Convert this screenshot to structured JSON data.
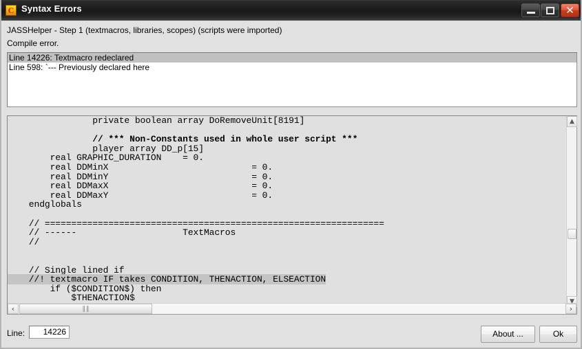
{
  "window": {
    "title": "Syntax Errors",
    "icon": "compiler-c-icon",
    "icon_letter": "C",
    "controls": {
      "minimize": "minimize-icon",
      "maximize": "maximize-icon",
      "close": "close-icon",
      "close_glyph": "✕"
    }
  },
  "header": {
    "line1": "JASSHelper - Step 1 (textmacros, libraries, scopes) (scripts were imported)",
    "line2": "Compile error."
  },
  "error_list": {
    "items": [
      {
        "text": "Line 14226: Textmacro redeclared",
        "selected": true
      },
      {
        "text": "Line 598: `--- Previously declared here",
        "selected": false
      }
    ]
  },
  "code_view": {
    "lines": [
      {
        "text": "                private boolean array DoRemoveUnit[8191]",
        "highlighted": false,
        "bold": false
      },
      {
        "text": "",
        "highlighted": false,
        "bold": false
      },
      {
        "text": "                // *** Non-Constants used in whole user script ***",
        "highlighted": false,
        "bold": true
      },
      {
        "text": "                player array DD_p[15]",
        "highlighted": false,
        "bold": false
      },
      {
        "text": "        real GRAPHIC_DURATION    = 0.",
        "highlighted": false,
        "bold": false
      },
      {
        "text": "        real DDMinX                           = 0.",
        "highlighted": false,
        "bold": false
      },
      {
        "text": "        real DDMinY                           = 0.",
        "highlighted": false,
        "bold": false
      },
      {
        "text": "        real DDMaxX                           = 0.",
        "highlighted": false,
        "bold": false
      },
      {
        "text": "        real DDMaxY                           = 0.",
        "highlighted": false,
        "bold": false
      },
      {
        "text": "    endglobals",
        "highlighted": false,
        "bold": false
      },
      {
        "text": "",
        "highlighted": false,
        "bold": false
      },
      {
        "text": "    // ================================================================",
        "highlighted": false,
        "bold": false
      },
      {
        "text": "    // ------                    TextMacros",
        "highlighted": false,
        "bold": false
      },
      {
        "text": "    //",
        "highlighted": false,
        "bold": false
      },
      {
        "text": "",
        "highlighted": false,
        "bold": false
      },
      {
        "text": "",
        "highlighted": false,
        "bold": false
      },
      {
        "text": "    // Single lined if",
        "highlighted": false,
        "bold": false
      },
      {
        "text": "    //! textmacro IF takes CONDITION, THENACTION, ELSEACTION",
        "highlighted": true,
        "bold": false
      },
      {
        "text": "        if ($CONDITION$) then",
        "highlighted": false,
        "bold": false
      },
      {
        "text": "            $THENACTION$",
        "highlighted": false,
        "bold": false
      }
    ],
    "vertical_scrollbar": {
      "up_arrow": "▲",
      "down_arrow": "▼"
    },
    "horizontal_scrollbar": {
      "left_arrow": "‹",
      "right_arrow": "›",
      "grip": "‖‖"
    }
  },
  "footer": {
    "line_label": "Line:",
    "line_value": "14226",
    "about_button": "About ...",
    "ok_button": "Ok"
  },
  "colors": {
    "selection": "#c0c0c0",
    "code_background": "#e0e0e0",
    "window_background": "#e1e1e1",
    "close_button": "#c63d1f",
    "icon_yellow": "#f7b200"
  }
}
